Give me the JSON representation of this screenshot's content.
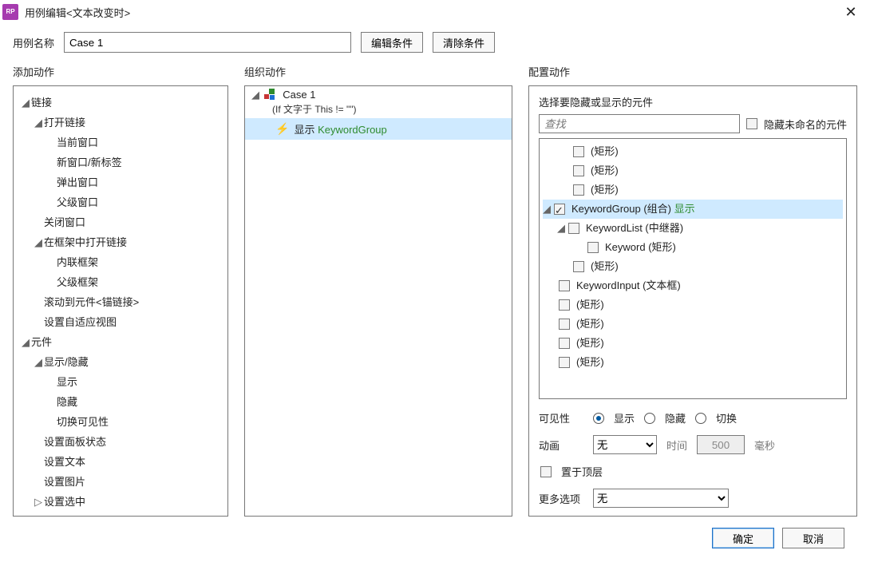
{
  "window": {
    "title": "用例编辑<文本改变时>"
  },
  "nameRow": {
    "label": "用例名称",
    "value": "Case 1",
    "editBtn": "编辑条件",
    "clearBtn": "清除条件"
  },
  "headers": {
    "addAction": "添加动作",
    "organize": "组织动作",
    "config": "配置动作"
  },
  "addActions": {
    "links": "链接",
    "openLink": "打开链接",
    "openLink_items": {
      "cur": "当前窗口",
      "new": "新窗口/新标签",
      "popup": "弹出窗口",
      "parent": "父级窗口"
    },
    "closeWin": "关闭窗口",
    "openInFrame": "在框架中打开链接",
    "openInFrame_items": {
      "inline": "内联框架",
      "parent": "父级框架"
    },
    "scrollAnchor": "滚动到元件<锚链接>",
    "adaptive": "设置自适应视图",
    "widgets": "元件",
    "showHide": "显示/隐藏",
    "showHide_items": {
      "show": "显示",
      "hide": "隐藏",
      "toggle": "切换可见性"
    },
    "panelState": "设置面板状态",
    "setText": "设置文本",
    "setImage": "设置图片",
    "setSelected": "设置选中"
  },
  "organize": {
    "caseName": "Case 1",
    "condition": "(If 文字于 This != \"\")",
    "actionPrefix": "显示 ",
    "actionTarget": "KeywordGroup"
  },
  "config": {
    "title": "选择要隐藏或显示的元件",
    "searchPlaceholder": "查找",
    "hideUnnamed": "隐藏未命名的元件",
    "widgets": {
      "rect": "(矩形)",
      "keywordGroup": "KeywordGroup (组合)",
      "keywordGroupState": "显示",
      "keywordList": "KeywordList (中继器)",
      "keyword": "Keyword (矩形)",
      "keywordInput": "KeywordInput (文本框)"
    },
    "visibilityLabel": "可见性",
    "vis": {
      "show": "显示",
      "hide": "隐藏",
      "toggle": "切换"
    },
    "animLabel": "动画",
    "animNone": "无",
    "timeLabel": "时间",
    "timeValue": "500",
    "ms": "毫秒",
    "bringFront": "置于顶层",
    "moreLabel": "更多选项",
    "moreNone": "无"
  },
  "footer": {
    "ok": "确定",
    "cancel": "取消"
  }
}
